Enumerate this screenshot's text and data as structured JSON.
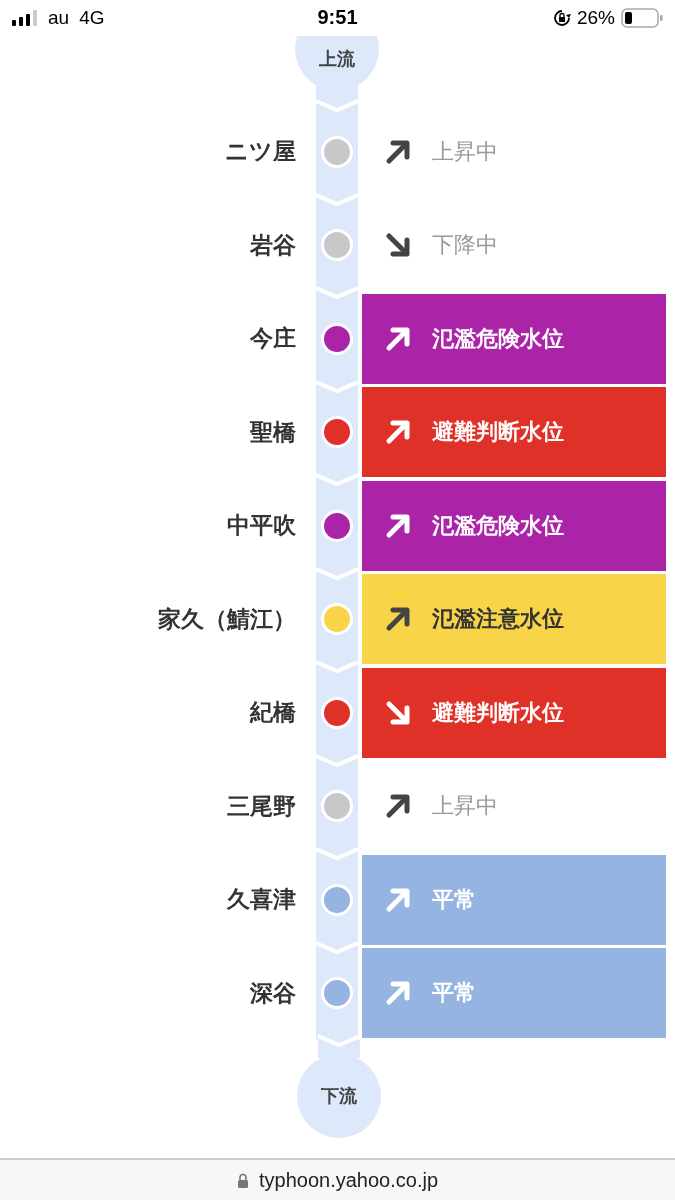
{
  "status_bar": {
    "carrier": "au",
    "network": "4G",
    "time": "9:51",
    "battery": "26%"
  },
  "upstream": "上流",
  "stations": [
    {
      "name": "ニツ屋",
      "color": "#c8c8c8",
      "kind": "plain",
      "rising": true,
      "status": "上昇中"
    },
    {
      "name": "岩谷",
      "color": "#c8c8c8",
      "kind": "plain",
      "rising": false,
      "status": "下降中"
    },
    {
      "name": "今庄",
      "color": "#ab24a8",
      "kind": "band",
      "rising": true,
      "status": "氾濫危険水位"
    },
    {
      "name": "聖橋",
      "color": "#e03128",
      "kind": "band",
      "rising": true,
      "status": "避難判断水位"
    },
    {
      "name": "中平吹",
      "color": "#ab24a8",
      "kind": "band",
      "rising": true,
      "status": "氾濫危険水位"
    },
    {
      "name": "家久（鯖江）",
      "color": "#f7d448",
      "kind": "band-light",
      "rising": true,
      "status": "氾濫注意水位"
    },
    {
      "name": "紀橋",
      "color": "#e03128",
      "kind": "band",
      "rising": false,
      "status": "避難判断水位"
    },
    {
      "name": "三尾野",
      "color": "#c8c8c8",
      "kind": "plain",
      "rising": true,
      "status": "上昇中"
    },
    {
      "name": "久喜津",
      "color": "#95b4e2",
      "kind": "band",
      "rising": true,
      "status": "平常"
    },
    {
      "name": "深谷",
      "color": "#95b4e2",
      "kind": "band",
      "rising": true,
      "status": "平常"
    }
  ],
  "downstream": "下流",
  "url_bar": {
    "url": "typhoon.yahoo.co.jp"
  }
}
